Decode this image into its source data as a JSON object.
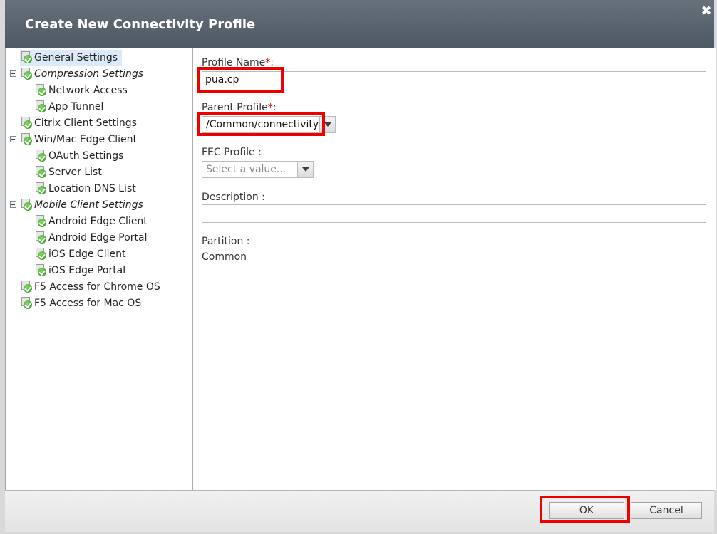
{
  "dialog": {
    "title": "Create New Connectivity Profile",
    "close_icon": "close-icon"
  },
  "tree": {
    "items": [
      {
        "label": "General Settings",
        "italic": false,
        "selected": true
      },
      {
        "label": "Compression Settings",
        "italic": true,
        "collapsible": true
      },
      {
        "label": "Network Access",
        "italic": false
      },
      {
        "label": "App Tunnel",
        "italic": false
      },
      {
        "label": "Citrix Client Settings",
        "italic": false
      },
      {
        "label": "Win/Mac Edge Client",
        "italic": false,
        "collapsible": true
      },
      {
        "label": "OAuth Settings",
        "italic": false
      },
      {
        "label": "Server List",
        "italic": false
      },
      {
        "label": "Location DNS List",
        "italic": false
      },
      {
        "label": "Mobile Client Settings",
        "italic": true,
        "collapsible": true
      },
      {
        "label": "Android Edge Client",
        "italic": false
      },
      {
        "label": "Android Edge Portal",
        "italic": false
      },
      {
        "label": "iOS Edge Client",
        "italic": false
      },
      {
        "label": "iOS Edge Portal",
        "italic": false
      },
      {
        "label": "F5 Access for Chrome OS",
        "italic": false
      },
      {
        "label": "F5 Access for Mac OS",
        "italic": false
      }
    ]
  },
  "form": {
    "profile_name_label": "Profile Name",
    "profile_name_value": "pua.cp",
    "parent_profile_label": "Parent Profile",
    "parent_profile_value": "/Common/connectivity",
    "fec_profile_label": "FEC Profile",
    "fec_profile_placeholder": "Select a value...",
    "description_label": "Description",
    "description_value": "",
    "partition_label": "Partition",
    "partition_value": "Common",
    "required_marker": "*",
    "required_suffix": ":",
    "optional_suffix": " :"
  },
  "footer": {
    "ok_label": "OK",
    "cancel_label": "Cancel"
  },
  "colors": {
    "titlebar": "#5a646e",
    "selected_row": "#dbe9f8",
    "highlight": "#ee0000",
    "required": "#d00000"
  }
}
